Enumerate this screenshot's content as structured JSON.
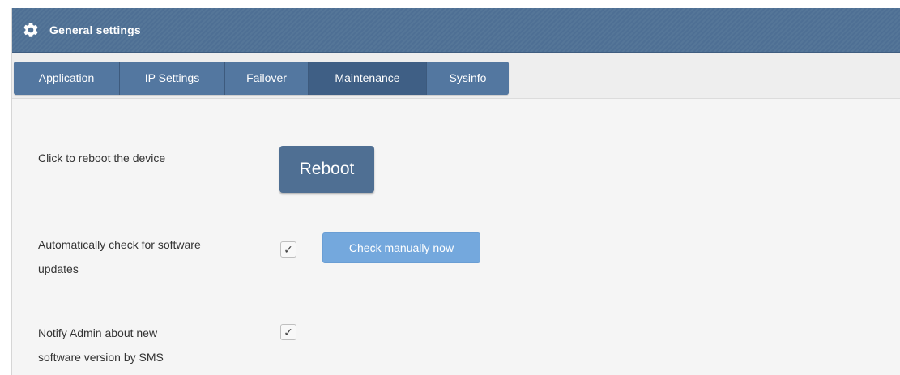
{
  "header": {
    "icon": "gear-icon",
    "title": "General settings",
    "background_color": "#4e6f94"
  },
  "tabs": [
    {
      "label": "Application",
      "active": false
    },
    {
      "label": "IP Settings",
      "active": false
    },
    {
      "label": "Failover",
      "active": false
    },
    {
      "label": "Maintenance",
      "active": true
    },
    {
      "label": "Sysinfo",
      "active": false
    }
  ],
  "maintenance": {
    "reboot": {
      "label": "Click to reboot the device",
      "button_label": "Reboot"
    },
    "auto_update": {
      "label_line1": "Automatically check for software",
      "label_line2": "updates",
      "checked": true,
      "button_label": "Check manually now"
    },
    "notify_admin": {
      "label_line1": "Notify Admin about new",
      "label_line2": "software version by SMS",
      "checked": true
    }
  },
  "colors": {
    "accent": "#4f6f93",
    "active_tab": "#3f5f85",
    "secondary_button": "#74a8dd"
  }
}
